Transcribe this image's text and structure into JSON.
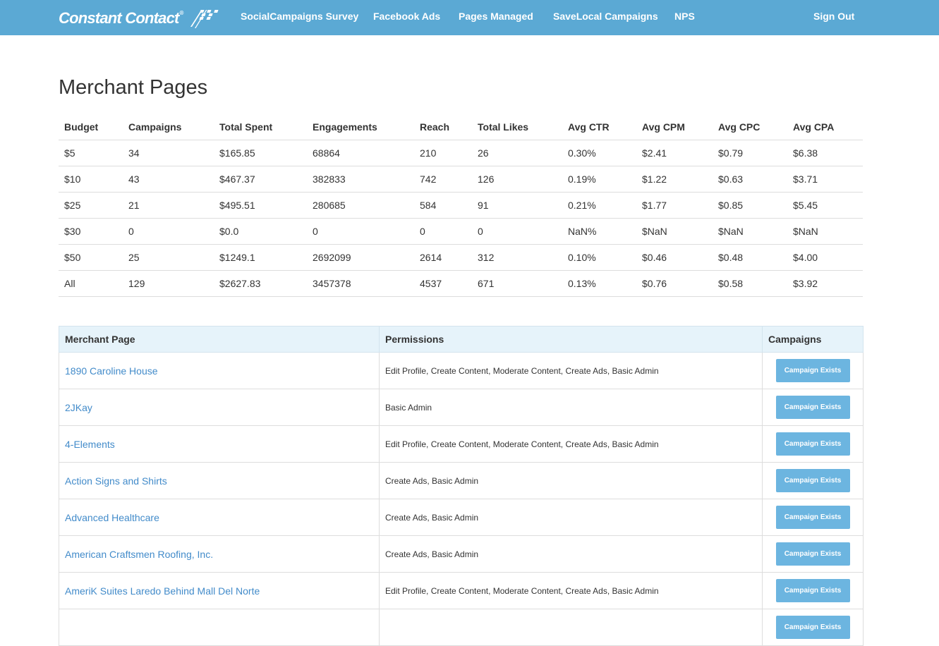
{
  "navbar": {
    "brand": "Constant Contact",
    "brand_mark": "®",
    "links": [
      "SocialCampaigns Survey",
      "Facebook Ads",
      "Pages Managed",
      "SaveLocal Campaigns",
      "NPS"
    ],
    "sign_out": "Sign Out"
  },
  "main": {
    "title": "Merchant Pages"
  },
  "stats_table": {
    "headers": [
      "Budget",
      "Campaigns",
      "Total Spent",
      "Engagements",
      "Reach",
      "Total Likes",
      "Avg CTR",
      "Avg CPM",
      "Avg CPC",
      "Avg CPA"
    ],
    "rows": [
      [
        "$5",
        "34",
        "$165.85",
        "68864",
        "210",
        "26",
        "0.30%",
        "$2.41",
        "$0.79",
        "$6.38"
      ],
      [
        "$10",
        "43",
        "$467.37",
        "382833",
        "742",
        "126",
        "0.19%",
        "$1.22",
        "$0.63",
        "$3.71"
      ],
      [
        "$25",
        "21",
        "$495.51",
        "280685",
        "584",
        "91",
        "0.21%",
        "$1.77",
        "$0.85",
        "$5.45"
      ],
      [
        "$30",
        "0",
        "$0.0",
        "0",
        "0",
        "0",
        "NaN%",
        "$NaN",
        "$NaN",
        "$NaN"
      ],
      [
        "$50",
        "25",
        "$1249.1",
        "2692099",
        "2614",
        "312",
        "0.10%",
        "$0.46",
        "$0.48",
        "$4.00"
      ],
      [
        "All",
        "129",
        "$2627.83",
        "3457378",
        "4537",
        "671",
        "0.13%",
        "$0.76",
        "$0.58",
        "$3.92"
      ]
    ]
  },
  "pages_table": {
    "headers": [
      "Merchant Page",
      "Permissions",
      "Campaigns"
    ],
    "button_label": "Campaign Exists",
    "rows": [
      {
        "name": "1890 Caroline House",
        "permissions": "Edit Profile, Create Content, Moderate Content, Create Ads, Basic Admin"
      },
      {
        "name": "2JKay",
        "permissions": "Basic Admin"
      },
      {
        "name": "4-Elements",
        "permissions": "Edit Profile, Create Content, Moderate Content, Create Ads, Basic Admin"
      },
      {
        "name": "Action Signs and Shirts",
        "permissions": "Create Ads, Basic Admin"
      },
      {
        "name": "Advanced Healthcare",
        "permissions": "Create Ads, Basic Admin"
      },
      {
        "name": "American Craftsmen Roofing, Inc.",
        "permissions": "Create Ads, Basic Admin"
      },
      {
        "name": "AmeriK Suites Laredo Behind Mall Del Norte",
        "permissions": "Edit Profile, Create Content, Moderate Content, Create Ads, Basic Admin"
      },
      {
        "name": "",
        "permissions": ""
      }
    ]
  },
  "colors": {
    "navbar": "#5ba9d4",
    "table_header": "#e6f3fa",
    "link": "#428bca",
    "button": "#6cb5e0"
  },
  "icons": {
    "brand_logo": "checkered-flag-icon"
  }
}
